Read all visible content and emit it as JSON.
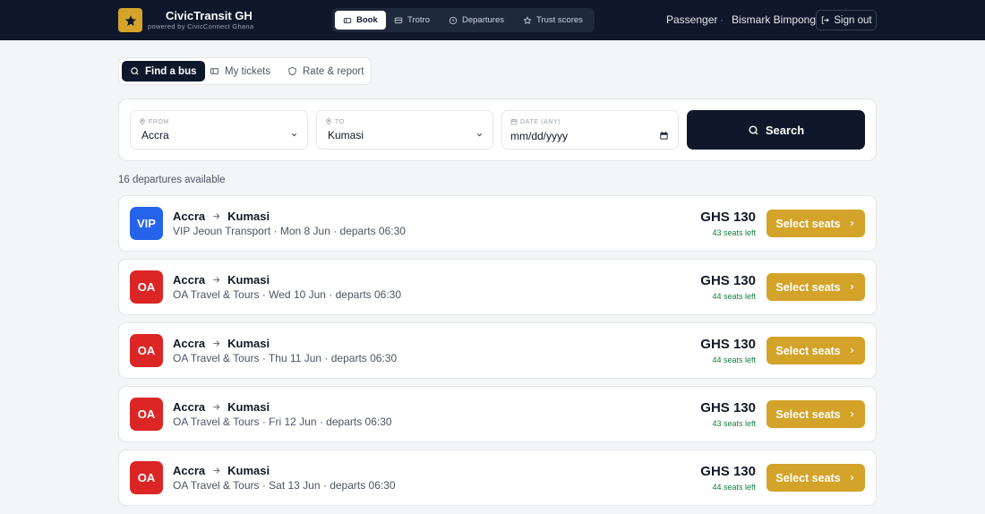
{
  "header": {
    "brand_title": "CivicTransit GH",
    "brand_subtitle": "powered by CivicConnect Ghana",
    "nav": [
      {
        "label": "Book",
        "icon": "ticket-icon",
        "active": true
      },
      {
        "label": "Trotro",
        "icon": "bus-icon",
        "active": false
      },
      {
        "label": "Departures",
        "icon": "clock-icon",
        "active": false
      },
      {
        "label": "Trust scores",
        "icon": "star-icon",
        "active": false
      }
    ],
    "user_role": "Passenger",
    "separator": "·",
    "user_name": "Bismark Bimpong",
    "signout_label": "Sign out"
  },
  "subtabs": [
    {
      "label": "Find a bus",
      "icon": "search-icon",
      "active": true
    },
    {
      "label": "My tickets",
      "icon": "ticket-icon",
      "active": false
    },
    {
      "label": "Rate & report",
      "icon": "shield-icon",
      "active": false
    }
  ],
  "search": {
    "from_label": "FROM",
    "from_value": "Accra",
    "to_label": "TO",
    "to_value": "Kumasi",
    "date_label": "DATE (ANY)",
    "date_placeholder": "mm/dd/yyyy",
    "button_label": "Search"
  },
  "results_count": "16 departures available",
  "results": [
    {
      "badge": "VIP",
      "badge_color": "#2563eb",
      "from": "Accra",
      "to": "Kumasi",
      "details": "VIP Jeoun Transport · Mon 8 Jun · departs 06:30",
      "price": "GHS 130",
      "seats": "43 seats left",
      "button": "Select seats"
    },
    {
      "badge": "OA",
      "badge_color": "#dc2626",
      "from": "Accra",
      "to": "Kumasi",
      "details": "OA Travel & Tours · Wed 10 Jun · departs 06:30",
      "price": "GHS 130",
      "seats": "44 seats left",
      "button": "Select seats"
    },
    {
      "badge": "OA",
      "badge_color": "#dc2626",
      "from": "Accra",
      "to": "Kumasi",
      "details": "OA Travel & Tours · Thu 11 Jun · departs 06:30",
      "price": "GHS 130",
      "seats": "44 seats left",
      "button": "Select seats"
    },
    {
      "badge": "OA",
      "badge_color": "#dc2626",
      "from": "Accra",
      "to": "Kumasi",
      "details": "OA Travel & Tours · Fri 12 Jun · departs 06:30",
      "price": "GHS 130",
      "seats": "43 seats left",
      "button": "Select seats"
    },
    {
      "badge": "OA",
      "badge_color": "#dc2626",
      "from": "Accra",
      "to": "Kumasi",
      "details": "OA Travel & Tours · Sat 13 Jun · departs 06:30",
      "price": "GHS 130",
      "seats": "44 seats left",
      "button": "Select seats"
    }
  ],
  "colors": {
    "navy": "#0f172a",
    "gold": "#d4a32a",
    "green": "#15803d"
  }
}
